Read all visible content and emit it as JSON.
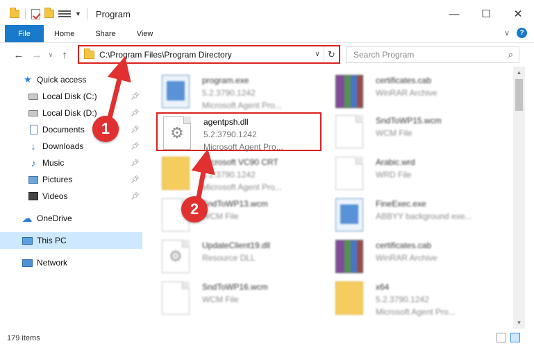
{
  "window": {
    "title": "Program",
    "controls": {
      "minimize": "—",
      "maximize": "☐",
      "close": "✕"
    }
  },
  "ribbon": {
    "tabs": [
      "File",
      "Home",
      "Share",
      "View"
    ],
    "help": "?"
  },
  "nav": {
    "address": "C:\\Program Files\\Program Directory",
    "search_placeholder": "Search Program"
  },
  "sidebar": {
    "items": [
      {
        "label": "Quick access",
        "icon": "star-icon"
      },
      {
        "label": "Local Disk (C:)",
        "icon": "drive-icon",
        "pinned": true
      },
      {
        "label": "Local Disk (D:)",
        "icon": "drive-icon",
        "pinned": true
      },
      {
        "label": "Documents",
        "icon": "documents-icon",
        "pinned": true
      },
      {
        "label": "Downloads",
        "icon": "download-icon",
        "pinned": true
      },
      {
        "label": "Music",
        "icon": "music-icon",
        "pinned": true
      },
      {
        "label": "Pictures",
        "icon": "pictures-icon",
        "pinned": true
      },
      {
        "label": "Videos",
        "icon": "videos-icon",
        "pinned": true
      },
      {
        "label": "OneDrive",
        "icon": "cloud-icon"
      },
      {
        "label": "This PC",
        "icon": "pc-icon",
        "selected": true
      },
      {
        "label": "Network",
        "icon": "network-icon"
      }
    ]
  },
  "files": [
    {
      "name": "program.exe",
      "meta1": "5.2.3790.1242",
      "meta2": "Microsoft Agent Pro...",
      "kind": "exe"
    },
    {
      "name": "certificates.cab",
      "meta1": "WinRAR Archive",
      "meta2": "",
      "kind": "rar"
    },
    {
      "name": "agentpsh.dll",
      "meta1": "5.2.3790.1242",
      "meta2": "Microsoft Agent Pro...",
      "kind": "dll"
    },
    {
      "name": "SndToWP15.wcm",
      "meta1": "WCM File",
      "meta2": "",
      "kind": "page"
    },
    {
      "name": "Microsoft VC90 CRT",
      "meta1": "5.2.3790.1242",
      "meta2": "Microsoft Agent Pro...",
      "kind": "folder"
    },
    {
      "name": "Arabic.wrd",
      "meta1": "WRD File",
      "meta2": "",
      "kind": "page"
    },
    {
      "name": "SndToWP13.wcm",
      "meta1": "WCM File",
      "meta2": "",
      "kind": "page"
    },
    {
      "name": "FineExec.exe",
      "meta1": "ABBYY background exe...",
      "meta2": "",
      "kind": "exe"
    },
    {
      "name": "UpdateClient19.dll",
      "meta1": "Resource DLL",
      "meta2": "",
      "kind": "dll"
    },
    {
      "name": "certificates.cab",
      "meta1": "WinRAR Archive",
      "meta2": "",
      "kind": "rar"
    },
    {
      "name": "SndToWP16.wcm",
      "meta1": "WCM File",
      "meta2": "",
      "kind": "page"
    },
    {
      "name": "x64",
      "meta1": "5.2.3790.1242",
      "meta2": "Microsoft Agent Pro...",
      "kind": "folder"
    }
  ],
  "status": {
    "items": "179 items"
  },
  "callouts": {
    "step1": "1",
    "step2": "2"
  },
  "colors": {
    "accent": "#1979ca",
    "highlight": "#dc2020",
    "callout": "#e03030",
    "selected": "#cde8ff"
  }
}
